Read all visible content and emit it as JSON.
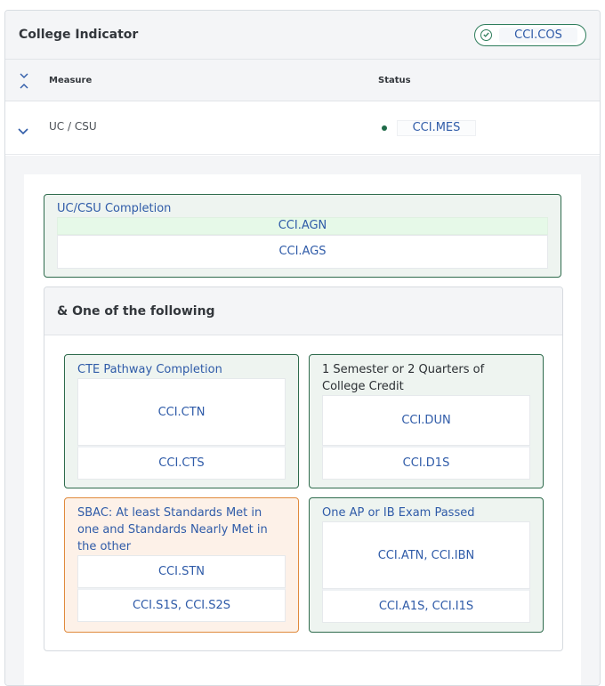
{
  "header": {
    "title": "College Indicator",
    "status_code": "CCI.COS"
  },
  "table": {
    "col_measure": "Measure",
    "col_status": "Status",
    "rows": [
      {
        "measure": "UC / CSU",
        "status_code": "CCI.MES"
      }
    ]
  },
  "detail": {
    "requirement": {
      "title": "UC/CSU Completion",
      "codes": [
        "CCI.AGN",
        "CCI.AGS"
      ]
    },
    "one_of": {
      "title": "& One of the following",
      "options": [
        {
          "title": "CTE Pathway Completion",
          "codes": [
            "CCI.CTN",
            "CCI.CTS"
          ]
        },
        {
          "title": "1 Semester or 2 Quarters of College Credit",
          "codes": [
            "CCI.DUN",
            "CCI.D1S"
          ]
        },
        {
          "title": "SBAC: At least Standards Met in one and Standards Nearly Met in the other",
          "codes": [
            "CCI.STN",
            "CCI.S1S, CCI.S2S"
          ]
        },
        {
          "title": "One AP or IB Exam Passed",
          "codes": [
            "CCI.ATN, CCI.IBN",
            "CCI.A1S, CCI.I1S"
          ]
        }
      ]
    }
  },
  "colors": {
    "accent_blue": "#2f5ba8",
    "status_green": "#2e7d5b",
    "warning_orange": "#e08a3c"
  },
  "icons": {
    "header_status": "check-circle-icon",
    "sort_toggle": "expand-collapse-icon",
    "row_toggle": "chevron-down-icon"
  }
}
